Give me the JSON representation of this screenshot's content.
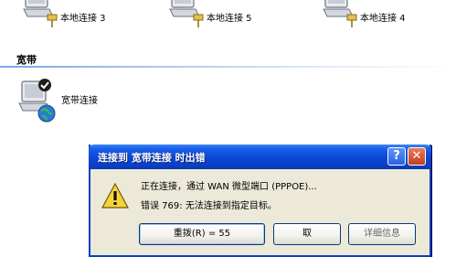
{
  "connections": [
    {
      "label": "本地连接 3"
    },
    {
      "label": "本地连接 5"
    },
    {
      "label": "本地连接 4"
    }
  ],
  "section": {
    "title": "宽带"
  },
  "broadband": {
    "label": "宽带连接"
  },
  "dialog": {
    "title": "连接到 宽带连接 时出错",
    "help_glyph": "?",
    "close_glyph": "✕",
    "message_line1": "正在连接，通过 WAN 微型端口 (PPPOE)...",
    "message_line2": "错误 769: 无法连接到指定目标。",
    "buttons": {
      "redial": "重拨(R) = 55",
      "cancel": "取",
      "more": "详细信息"
    }
  },
  "colors": {
    "titlebar": "#0a46d6",
    "dialog_bg": "#ece9d8",
    "close_button": "#c1401d"
  }
}
